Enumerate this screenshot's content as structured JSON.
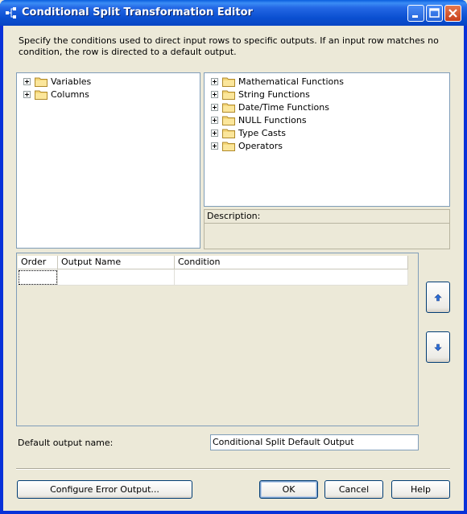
{
  "window": {
    "title": "Conditional Split Transformation Editor"
  },
  "description": "Specify the conditions used to direct input rows to specific outputs. If an input row matches no condition, the row is directed to a default output.",
  "left_tree": {
    "items": [
      {
        "label": "Variables",
        "icon": "folder-icon"
      },
      {
        "label": "Columns",
        "icon": "folder-icon"
      }
    ]
  },
  "right_tree": {
    "items": [
      {
        "label": "Mathematical Functions",
        "icon": "folder-icon"
      },
      {
        "label": "String Functions",
        "icon": "folder-icon"
      },
      {
        "label": "Date/Time Functions",
        "icon": "folder-icon"
      },
      {
        "label": "NULL Functions",
        "icon": "folder-icon"
      },
      {
        "label": "Type Casts",
        "icon": "folder-icon"
      },
      {
        "label": "Operators",
        "icon": "folder-icon"
      }
    ]
  },
  "description_panel": {
    "header": "Description:",
    "value": ""
  },
  "grid": {
    "columns": [
      "Order",
      "Output Name",
      "Condition"
    ],
    "rows": [
      {
        "order": "",
        "output_name": "",
        "condition": ""
      }
    ]
  },
  "default_output": {
    "label": "Default output name:",
    "value": "Conditional Split Default Output"
  },
  "buttons": {
    "configure_error": "Configure Error Output...",
    "ok": "OK",
    "cancel": "Cancel",
    "help": "Help"
  },
  "colors": {
    "titlebar": "#0a4fd0",
    "dialog_bg": "#ece9d8",
    "border": "#7f9db9",
    "folder": "#f5d77a"
  }
}
